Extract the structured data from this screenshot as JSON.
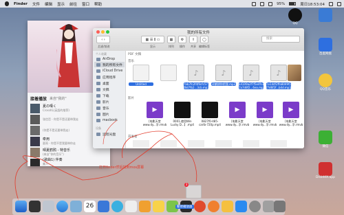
{
  "menubar": {
    "items": [
      "Finder",
      "文件",
      "编辑",
      "显示",
      "前往",
      "窗口",
      "帮助"
    ],
    "battery": "95%",
    "clock": "周日18:53:04"
  },
  "music": {
    "tabs": [
      "接着播放",
      "来自\"我的\"",
      "歌"
    ],
    "songs": [
      {
        "title": "夏の嘆く",
        "sub": "CrossKL(英語的推荐)"
      },
      {
        "title": "",
        "sub": "张信哲 - 你是不是还要带我走"
      },
      {
        "title": "",
        "sub": "(你是不是还要带我走)"
      },
      {
        "title": "牵用",
        "sub": "夏雨 - 你是不是我要带你走"
      },
      {
        "title": "晴夏鹤鸦 - 特音乐",
        "sub": "(来自\"你的音乐\")"
      },
      {
        "title": "(歌曲1) 伴奏",
        "sub": "美人"
      }
    ]
  },
  "finder": {
    "title": "我的所有文件",
    "toolbar": [
      "后退/前进",
      "显示",
      "排列",
      "操作",
      "共享",
      "编辑标签"
    ],
    "search_placeholder": "搜索",
    "sidebar": {
      "section_personal": "个人收藏",
      "items": [
        "AirDrop",
        "我的所有文件",
        "iCloud Drive",
        "应用程序",
        "桌面",
        "文稿",
        "下载",
        "影片",
        "音乐",
        "图片",
        "macbook"
      ],
      "section_devices": "设备",
      "devices": [
        "远程光盘"
      ]
    },
    "sections": [
      "PDF 文稿",
      "音乐",
      "影片",
      "开发者"
    ],
    "files_music": [
      {
        "name": "Untitled",
        "type": "doc"
      },
      {
        "name": "",
        "type": "doc"
      },
      {
        "name": "feb7fc2f4f0cfc57\nf8d7fb2...3cb.mp3",
        "type": "music"
      },
      {
        "name": "邓紫棋你把我.mp3",
        "type": "music"
      },
      {
        "name": "a4109a2f7f5e4fc2\n7a7d8f2...6ea.mp3",
        "type": "music"
      },
      {
        "name": "7e144f2ffa8049f1\nf7d6f2f...b4d.mp3",
        "type": "music"
      },
      {
        "name": "",
        "type": "photo"
      }
    ],
    "files_movies": [
      {
        "name": "[电影天堂\nwww.dy...字.rmvb",
        "type": "video"
      },
      {
        "name": "0001.使用Win\nLucky D...】.mp4",
        "type": "black"
      },
      {
        "name": "0827f0-485-\ncarlb-720p.mp4",
        "type": "black"
      },
      {
        "name": "[电影天堂\nwww.dy...字.rmvb",
        "type": "video"
      },
      {
        "name": "[电影天堂\nwww.dy...字.rmvb",
        "type": "video"
      },
      {
        "name": "[电影天堂\nwww.dy...字.rmvb",
        "type": "video"
      }
    ]
  },
  "desktop_icons": [
    {
      "label": "QQ",
      "color": "#111111"
    },
    {
      "label": "",
      "color": "#3a7bd5"
    },
    {
      "label": "百度网盘",
      "color": "#2e6fe0"
    },
    {
      "label": "QQ音乐",
      "color": "#f2c53d"
    },
    {
      "label": "微信",
      "color": "#3cb034"
    },
    {
      "label": "Droid4X.app",
      "color": "#d03030"
    }
  ],
  "annotation": "打开finder然后找到mos屏幕",
  "drag_badge": "3",
  "dock_tooltip": "聚修播放器",
  "colors": {
    "accent": "#2d6ee0",
    "annotation": "#e23b2b",
    "video": "#7b3bc9"
  }
}
